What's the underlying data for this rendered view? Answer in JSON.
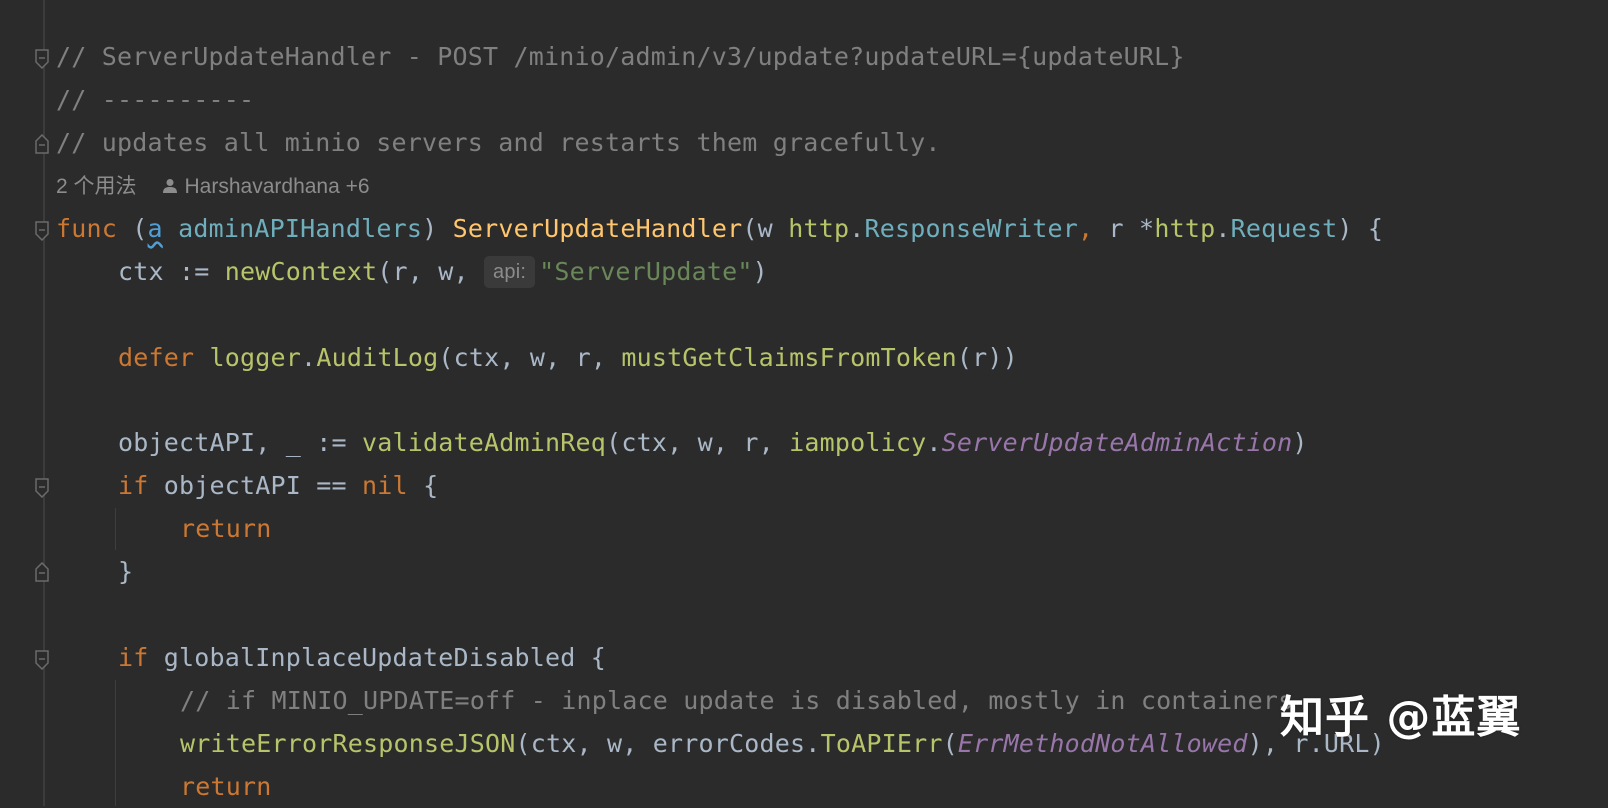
{
  "editor": {
    "lines": {
      "l1": "// ServerUpdateHandler - POST /minio/admin/v3/update?updateURL={updateURL}",
      "l2": "// ----------",
      "l3": "// updates all minio servers and restarts them gracefully.",
      "l4a": "func",
      "l4b": "(",
      "l4c": "a",
      "l4d": "adminAPIHandlers",
      "l4e": ")",
      "l4f": "ServerUpdateHandler",
      "l4g": "(w",
      "l4h": "http",
      "l4i": ".",
      "l4j": "ResponseWriter",
      "l4k": ",",
      "l4l": "r *",
      "l4m": "http",
      "l4n": ".",
      "l4o": "Request",
      "l4p": ") {",
      "l5a": "ctx := ",
      "l5b": "newContext",
      "l5c": "(r, w, ",
      "l5d": "\"ServerUpdate\"",
      "l5e": ")",
      "l7a": "defer",
      "l7b": "logger",
      "l7c": ".",
      "l7d": "AuditLog",
      "l7e": "(ctx, w, r, ",
      "l7f": "mustGetClaimsFromToken",
      "l7g": "(r))",
      "l9a": "objectAPI, _ := ",
      "l9b": "validateAdminReq",
      "l9c": "(ctx, w, r, ",
      "l9d": "iampolicy",
      "l9e": ".",
      "l9f": "ServerUpdateAdminAction",
      "l9g": ")",
      "l10a": "if",
      "l10b": " objectAPI == ",
      "l10c": "nil",
      "l10d": " {",
      "l11": "return",
      "l12": "}",
      "l14a": "if",
      "l14b": " globalInplaceUpdateDisabled {",
      "l15": "// if MINIO_UPDATE=off - inplace update is disabled, mostly in containers",
      "l16a": "writeErrorResponseJSON",
      "l16b": "(ctx, w, errorCodes.",
      "l16c": "ToAPIErr",
      "l16d": "(",
      "l16e": "ErrMethodNotAllowed",
      "l16f": "), r.URL)",
      "l17": "return"
    },
    "inlay_hint": "api:",
    "usages": "2 个用法",
    "authors": "Harshavardhana +6"
  },
  "watermark": "知乎 @蓝翼",
  "colors": {
    "background": "#2b2b2b",
    "comment": "#808080",
    "keyword": "#cc7832",
    "function": "#ffc66d",
    "string": "#6a8759",
    "constant": "#9876aa",
    "type": "#6fafbd"
  }
}
